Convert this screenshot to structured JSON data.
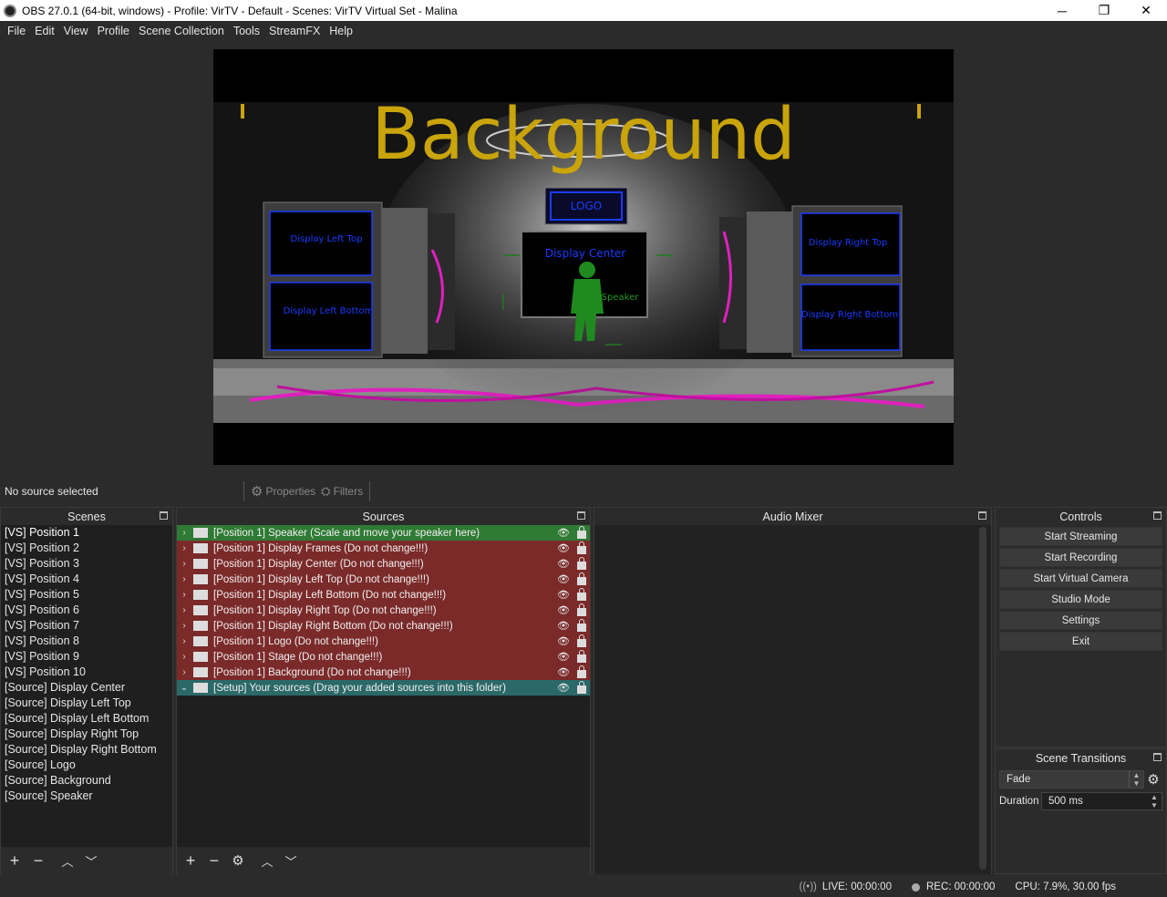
{
  "window": {
    "title": "OBS 27.0.1 (64-bit, windows) - Profile: VirTV - Default - Scenes: VirTV Virtual Set - Malina",
    "minimize": "─",
    "restore": "❐",
    "close": "✕"
  },
  "menu": [
    "File",
    "Edit",
    "View",
    "Profile",
    "Scene Collection",
    "Tools",
    "StreamFX",
    "Help"
  ],
  "preview": {
    "background_text": "Background",
    "logo_text": "LOGO",
    "display_center": "Display Center",
    "speaker": "Speaker",
    "display_left_top": "Display Left Top",
    "display_left_bottom": "Display Left Bottom",
    "display_right_top": "Display Right Top",
    "display_right_bottom": "Display Right Bottom",
    "colors": {
      "title": "#c9a40a",
      "accent": "#e020c0",
      "frame": "#1a3cff",
      "speaker": "#1f7a1f"
    }
  },
  "source_toolbar": {
    "no_source": "No source selected",
    "properties": "Properties",
    "filters": "Filters"
  },
  "scenes": {
    "header": "Scenes",
    "items": [
      "[VS] Position 1",
      "[VS] Position 2",
      "[VS] Position 3",
      "[VS] Position 4",
      "[VS] Position 5",
      "[VS] Position 6",
      "[VS] Position 7",
      "[VS] Position 8",
      "[VS] Position 9",
      "[VS] Position 10",
      "[Source] Display Center",
      "[Source] Display Left Top",
      "[Source] Display Left Bottom",
      "[Source] Display Right Top",
      "[Source] Display Right Bottom",
      "[Source] Logo",
      "[Source] Background",
      "[Source] Speaker"
    ]
  },
  "sources": {
    "header": "Sources",
    "items": [
      {
        "label": "[Position 1] Speaker (Scale and move your speaker here)",
        "color": "green",
        "chev": "›"
      },
      {
        "label": "[Position 1] Display Frames (Do not change!!!)",
        "color": "red",
        "chev": "›"
      },
      {
        "label": "[Position 1] Display Center (Do not change!!!)",
        "color": "red",
        "chev": "›"
      },
      {
        "label": "[Position 1] Display Left Top (Do not change!!!)",
        "color": "red",
        "chev": "›"
      },
      {
        "label": "[Position 1] Display Left Bottom (Do not change!!!)",
        "color": "red",
        "chev": "›"
      },
      {
        "label": "[Position 1] Display Right Top (Do not change!!!)",
        "color": "red",
        "chev": "›"
      },
      {
        "label": "[Position 1] Display Right Bottom (Do not change!!!)",
        "color": "red",
        "chev": "›"
      },
      {
        "label": "[Position 1] Logo (Do not change!!!)",
        "color": "red",
        "chev": "›"
      },
      {
        "label": "[Position 1] Stage (Do not change!!!)",
        "color": "red",
        "chev": "›"
      },
      {
        "label": "[Position 1] Background (Do not change!!!)",
        "color": "red",
        "chev": "›"
      },
      {
        "label": "[Setup] Your sources (Drag your added sources into this folder)",
        "color": "teal",
        "chev": "⌄"
      }
    ]
  },
  "mixer": {
    "header": "Audio Mixer"
  },
  "controls": {
    "header": "Controls",
    "buttons": [
      "Start Streaming",
      "Start Recording",
      "Start Virtual Camera",
      "Studio Mode",
      "Settings",
      "Exit"
    ]
  },
  "transitions": {
    "header": "Scene Transitions",
    "selected": "Fade",
    "duration_label": "Duration",
    "duration_value": "500 ms"
  },
  "status": {
    "live": "LIVE: 00:00:00",
    "rec": "REC: 00:00:00",
    "cpu": "CPU: 7.9%, 30.00 fps"
  }
}
